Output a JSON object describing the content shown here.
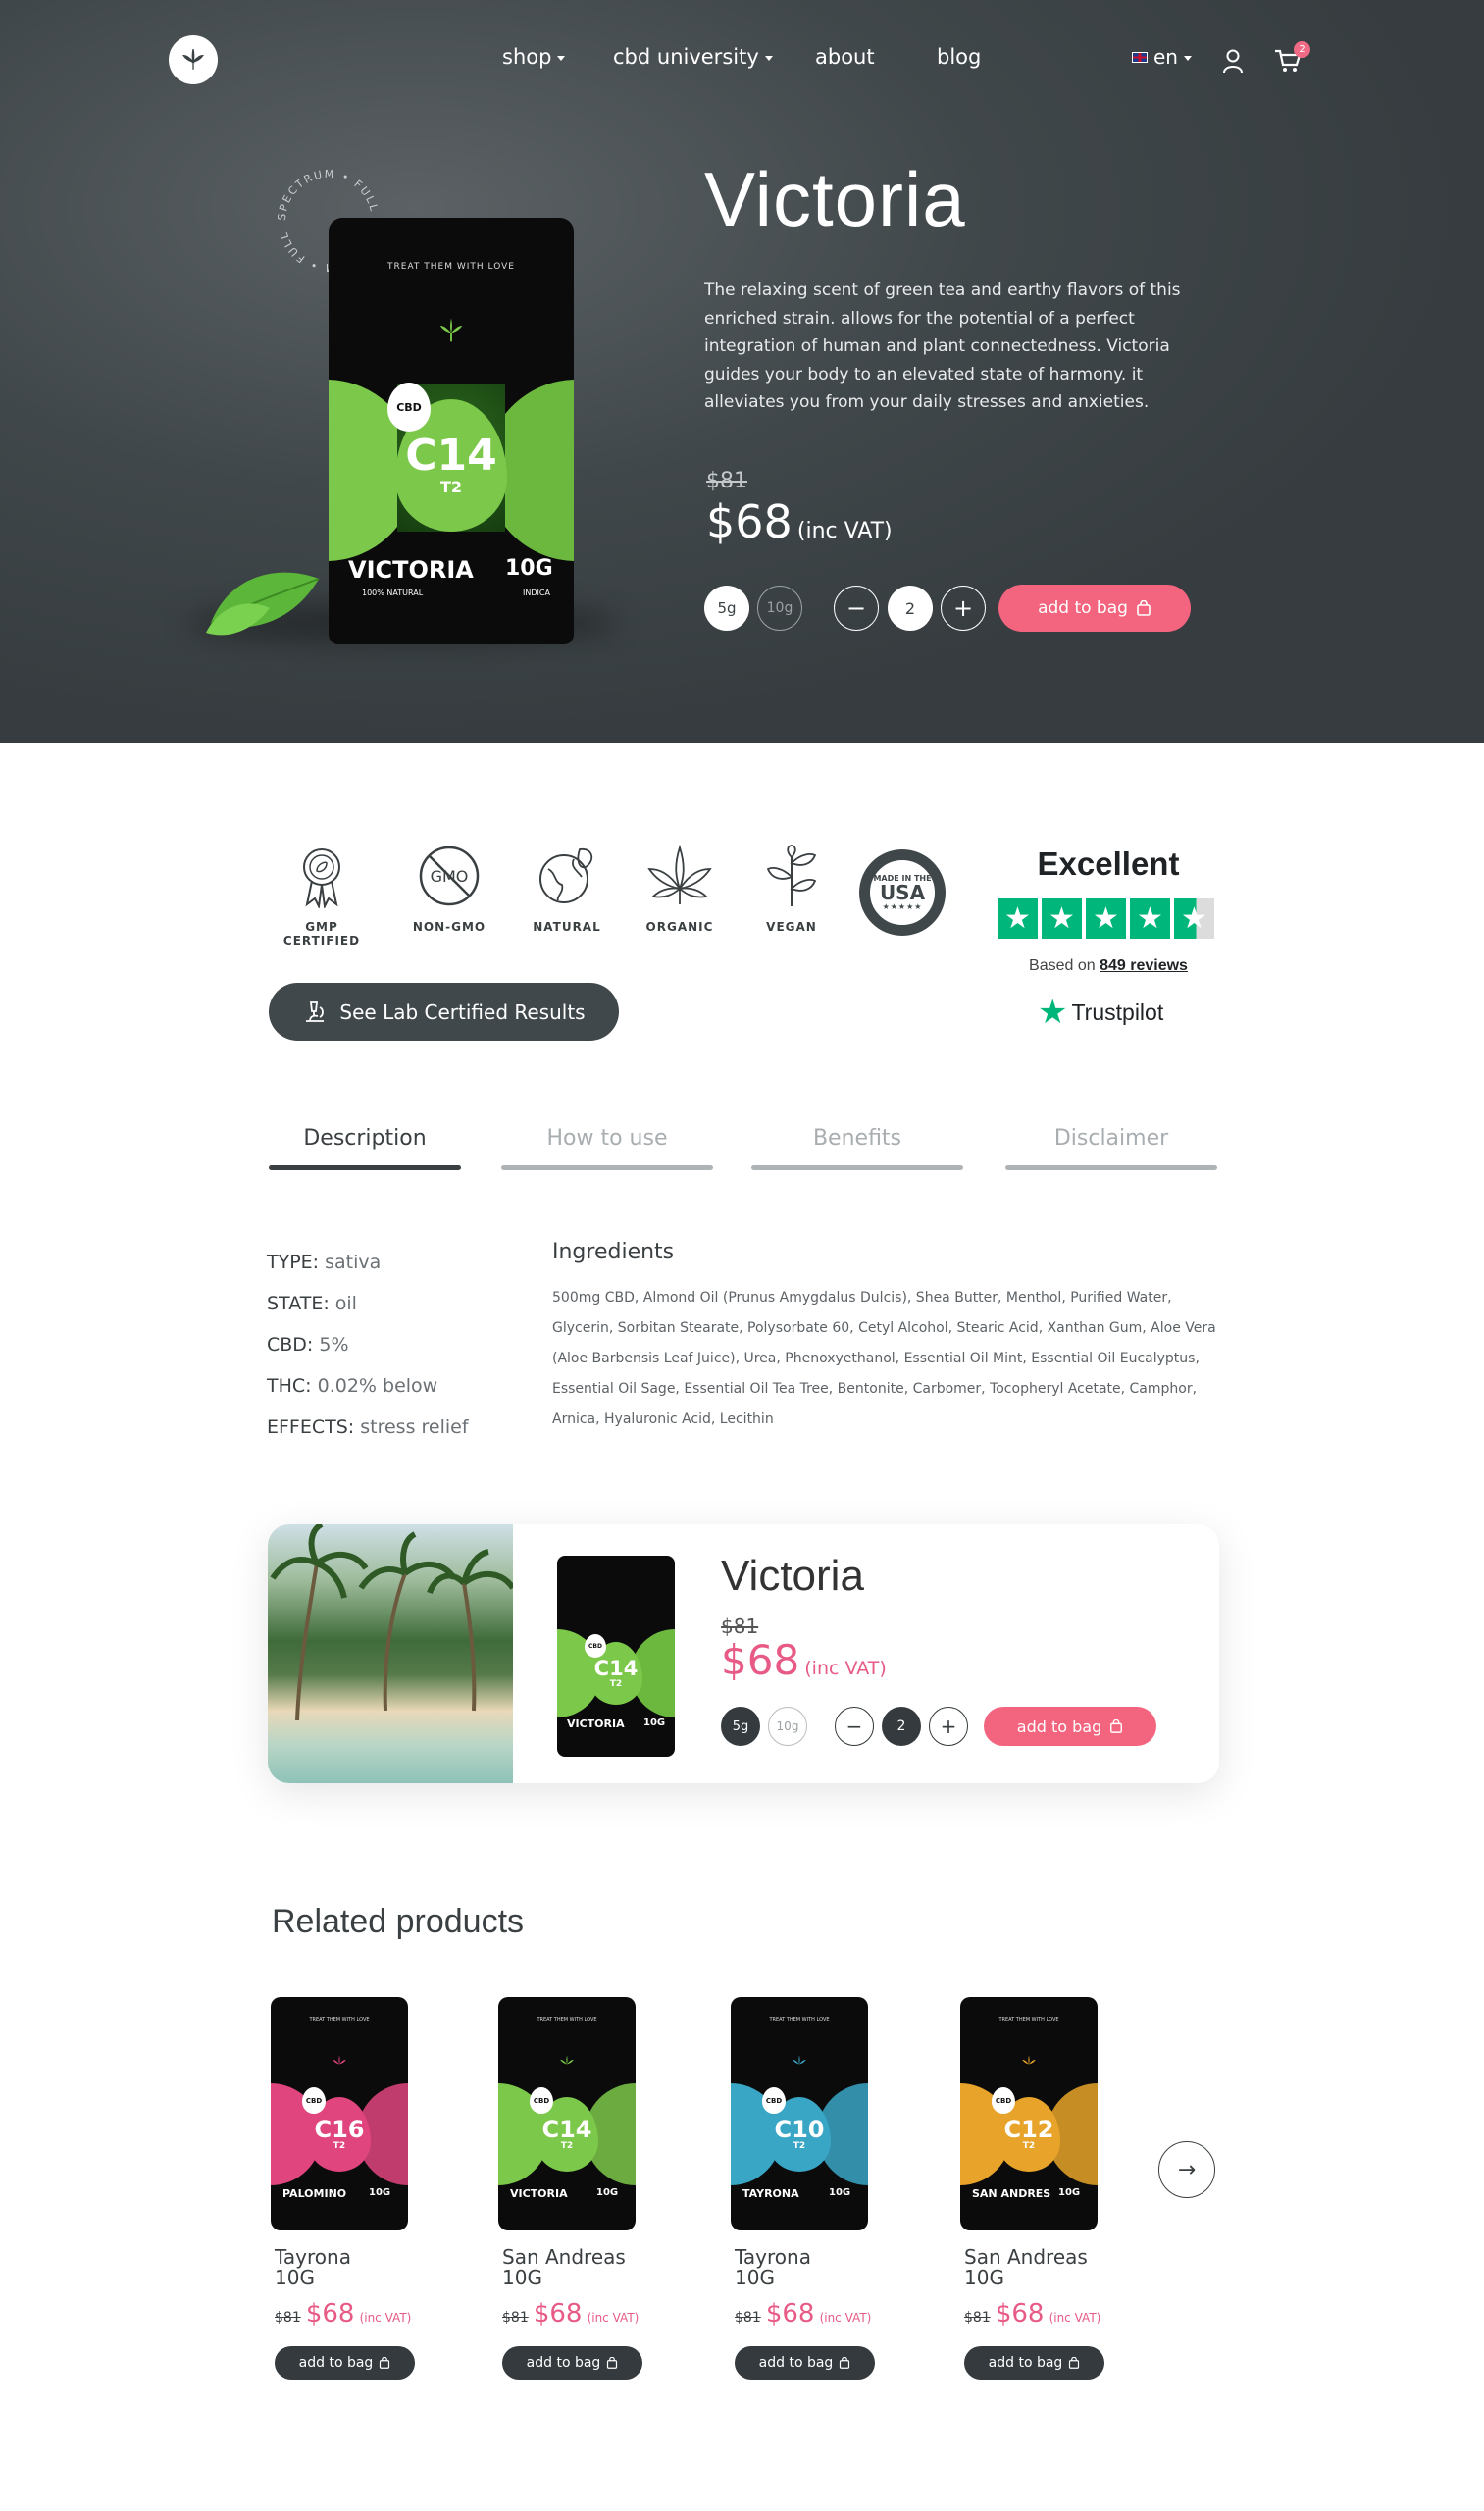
{
  "nav": {
    "items": [
      {
        "label": "shop",
        "dropdown": true
      },
      {
        "label": "cbd university",
        "dropdown": true
      },
      {
        "label": "about",
        "dropdown": false
      },
      {
        "label": "blog",
        "dropdown": false
      }
    ],
    "language": "en",
    "cart_count": "2"
  },
  "product": {
    "name": "Victoria",
    "description": "The relaxing scent of green tea and earthy flavors of this enriched strain. allows for the potential of a perfect integration of human and plant connectedness. Victoria guides your body to an elevated state of harmony. it alleviates you from your daily stresses and anxieties.",
    "old_price": "$81",
    "price": "$68",
    "price_note": "(inc VAT)",
    "sizes": [
      "5g",
      "10g"
    ],
    "selected_size": "5g",
    "quantity": "2",
    "add_label": "add to bag",
    "badge_text": "SPECTRUM • FULL SPECTRUM • FULL",
    "pack": {
      "top": "TREAT THEM WITH LOVE",
      "code": "C14",
      "sub": "T2",
      "small": "VICTORIA",
      "weight": "10G",
      "cbd": "CBD",
      "natural": "100% NATURAL",
      "type": "INDICA"
    }
  },
  "badges": [
    {
      "label": "GMP CERTIFIED",
      "icon": "award-ribbon-icon"
    },
    {
      "label": "NON-GMO",
      "icon": "non-gmo-icon"
    },
    {
      "label": "NATURAL",
      "icon": "globe-leaf-icon"
    },
    {
      "label": "ORGANIC",
      "icon": "cannabis-leaf-icon"
    },
    {
      "label": "VEGAN",
      "icon": "vegan-sprout-icon"
    }
  ],
  "usa_badge": {
    "line1": "MADE IN THE",
    "line2": "USA"
  },
  "trustpilot": {
    "rating_word": "Excellent",
    "based_on": "Based on",
    "reviews": "849 reviews",
    "brand": "Trustpilot"
  },
  "lab_button": "See Lab Certified Results",
  "tabs": [
    "Description",
    "How to use",
    "Benefits",
    "Disclaimer"
  ],
  "active_tab": "Description",
  "specs": [
    {
      "key": "TYPE:",
      "value": "sativa"
    },
    {
      "key": "STATE:",
      "value": "oil"
    },
    {
      "key": "CBD:",
      "value": "5%"
    },
    {
      "key": "THC:",
      "value": "0.02% below"
    },
    {
      "key": "EFFECTS:",
      "value": "stress relief"
    }
  ],
  "ingredients": {
    "title": "Ingredients",
    "text": "500mg CBD, Almond Oil (Prunus Amygdalus Dulcis), Shea Butter, Menthol, Purified Water, Glycerin, Sorbitan Stearate, Polysorbate 60, Cetyl Alcohol, Stearic Acid, Xanthan Gum, Aloe Vera (Aloe Barbensis Leaf Juice), Urea, Phenoxyethanol, Essential Oil Mint, Essential Oil Eucalyptus, Essential Oil Sage, Essential Oil Tea Tree, Bentonite, Carbomer, Tocopheryl Acetate, Camphor, Arnica, Hyaluronic Acid, Lecithin"
  },
  "sticky_card": {
    "name": "Victoria",
    "old_price": "$81",
    "price": "$68",
    "price_note": "(inc VAT)",
    "sizes": [
      "5g",
      "10g"
    ],
    "quantity": "2",
    "add_label": "add to bag"
  },
  "related": {
    "title": "Related products",
    "items": [
      {
        "name": "Tayrona\n10G",
        "old_price": "$81",
        "price": "$68",
        "note": "(inc VAT)",
        "add": "add to bag",
        "code": "C16",
        "label": "PALOMINO",
        "color": "#e0457e"
      },
      {
        "name": "San Andreas\n10G",
        "old_price": "$81",
        "price": "$68",
        "note": "(inc VAT)",
        "add": "add to bag",
        "code": "C14",
        "label": "VICTORIA",
        "color": "#7cc84a"
      },
      {
        "name": "Tayrona\n10G",
        "old_price": "$81",
        "price": "$68",
        "note": "(inc VAT)",
        "add": "add to bag",
        "code": "C10",
        "label": "TAYRONA",
        "color": "#3aa6c6"
      },
      {
        "name": "San Andreas\n10G",
        "old_price": "$81",
        "price": "$68",
        "note": "(inc VAT)",
        "add": "add to bag",
        "code": "C12",
        "label": "SAN ANDRES",
        "color": "#e8a42a"
      }
    ],
    "pack_sub": "T2",
    "pack_weight": "10G",
    "pack_cbd": "CBD",
    "pack_top": "TREAT THEM WITH LOVE"
  },
  "colors": {
    "hero_bg": "#3b4245",
    "accent_pink": "#f3647e",
    "dark": "#343a3d",
    "trustpilot_green": "#00b67a",
    "pack_green": "#7cc84a"
  }
}
